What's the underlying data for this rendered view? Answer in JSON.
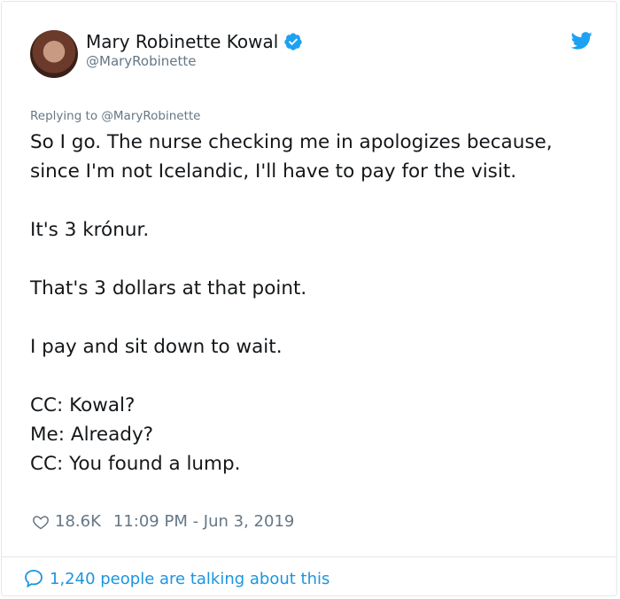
{
  "author": {
    "name": "Mary Robinette Kowal",
    "handle": "@MaryRobinette",
    "verified": true
  },
  "reply": {
    "prefix": "Replying to ",
    "mention": "@MaryRobinette"
  },
  "tweet": {
    "text": "So I go. The nurse checking me in apologizes because, since I'm not Icelandic, I'll have to pay for the visit.\n\nIt's 3 krónur.\n\nThat's 3 dollars at that point.\n\nI pay and sit down to wait.\n\nCC: Kowal?\nMe: Already?\nCC: You found a lump.",
    "likes": "18.6K",
    "time": "11:09 PM - Jun 3, 2019"
  },
  "footer": {
    "talking": "1,240 people are talking about this"
  },
  "colors": {
    "brand": "#1da1f2",
    "link": "#1b95e0",
    "muted": "#657786"
  },
  "icons": [
    "avatar",
    "verified-badge-icon",
    "twitter-bird-icon",
    "heart-icon",
    "speech-bubble-icon"
  ]
}
